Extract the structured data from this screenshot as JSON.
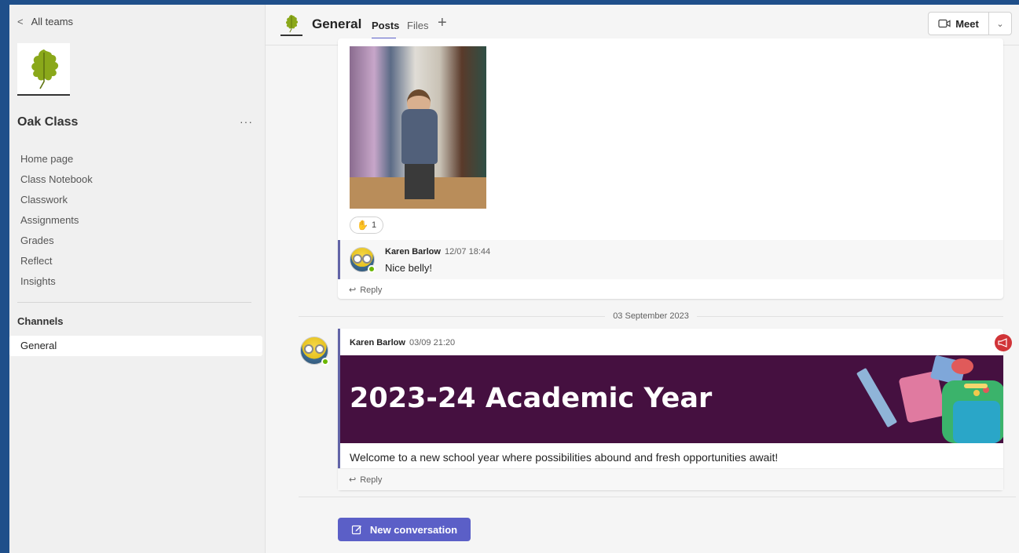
{
  "sidebar": {
    "back_label": "All teams",
    "team_name": "Oak Class",
    "team_more": "···",
    "nav_items": [
      {
        "label": "Home page"
      },
      {
        "label": "Class Notebook"
      },
      {
        "label": "Classwork"
      },
      {
        "label": "Assignments"
      },
      {
        "label": "Grades"
      },
      {
        "label": "Reflect"
      },
      {
        "label": "Insights"
      }
    ],
    "channels_label": "Channels",
    "channels": [
      {
        "label": "General",
        "selected": true
      }
    ]
  },
  "header": {
    "channel_title": "General",
    "tabs": [
      {
        "label": "Posts",
        "active": true
      },
      {
        "label": "Files",
        "active": false
      }
    ],
    "add_tab_label": "+",
    "meet_label": "Meet"
  },
  "feed": {
    "post1": {
      "reaction_count": "1",
      "reply": {
        "author": "Karen Barlow",
        "time": "12/07 18:44",
        "text": "Nice belly!"
      },
      "reply_link_label": "Reply"
    },
    "date_separator": "03 September 2023",
    "post2": {
      "author": "Karen Barlow",
      "time": "03/09 21:20",
      "banner_title": "2023-24 Academic Year",
      "body": "Welcome to a new school year where possibilities abound and fresh opportunities await!",
      "reply_link_label": "Reply"
    },
    "new_conversation_label": "New conversation"
  },
  "colors": {
    "accent": "#5b5fc7",
    "thread_accent": "#6264a7",
    "banner_bg": "#451040",
    "announcement_badge": "#d13438",
    "leaf": "#8aa81a",
    "presence_available": "#6bb700"
  }
}
